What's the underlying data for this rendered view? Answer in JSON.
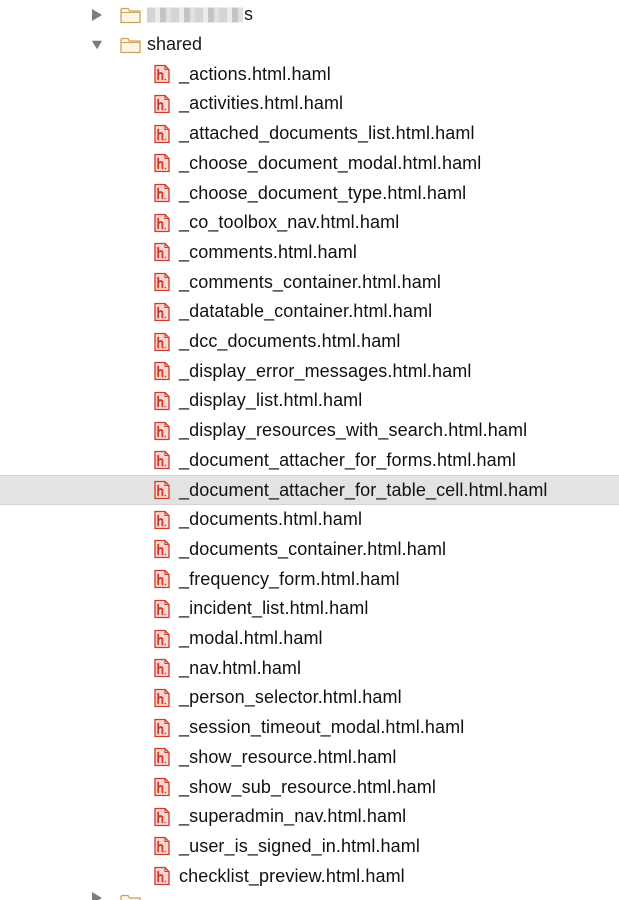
{
  "tree": {
    "collapsed_folder": {
      "name_suffix": "s",
      "icon": "folder-icon",
      "expand_icon": "triangle-right-icon"
    },
    "shared_folder": {
      "name": "shared",
      "icon": "folder-icon",
      "expand_icon": "triangle-down-icon"
    },
    "files": [
      "_actions.html.haml",
      "_activities.html.haml",
      "_attached_documents_list.html.haml",
      "_choose_document_modal.html.haml",
      "_choose_document_type.html.haml",
      "_co_toolbox_nav.html.haml",
      "_comments.html.haml",
      "_comments_container.html.haml",
      "_datatable_container.html.haml",
      "_dcc_documents.html.haml",
      "_display_error_messages.html.haml",
      "_display_list.html.haml",
      "_display_resources_with_search.html.haml",
      "_document_attacher_for_forms.html.haml",
      "_document_attacher_for_table_cell.html.haml",
      "_documents.html.haml",
      "_documents_container.html.haml",
      "_frequency_form.html.haml",
      "_incident_list.html.haml",
      "_modal.html.haml",
      "_nav.html.haml",
      "_person_selector.html.haml",
      "_session_timeout_modal.html.haml",
      "_show_resource.html.haml",
      "_show_sub_resource.html.haml",
      "_superadmin_nav.html.haml",
      "_user_is_signed_in.html.haml",
      "checklist_preview.html.haml"
    ],
    "selected_file": "_document_attacher_for_table_cell.html.haml",
    "file_icon": "haml-file-icon",
    "colors": {
      "selection_bg": "#e3e3e3",
      "file_icon_red": "#d23a2a",
      "folder_outline": "#c9a45a"
    }
  }
}
